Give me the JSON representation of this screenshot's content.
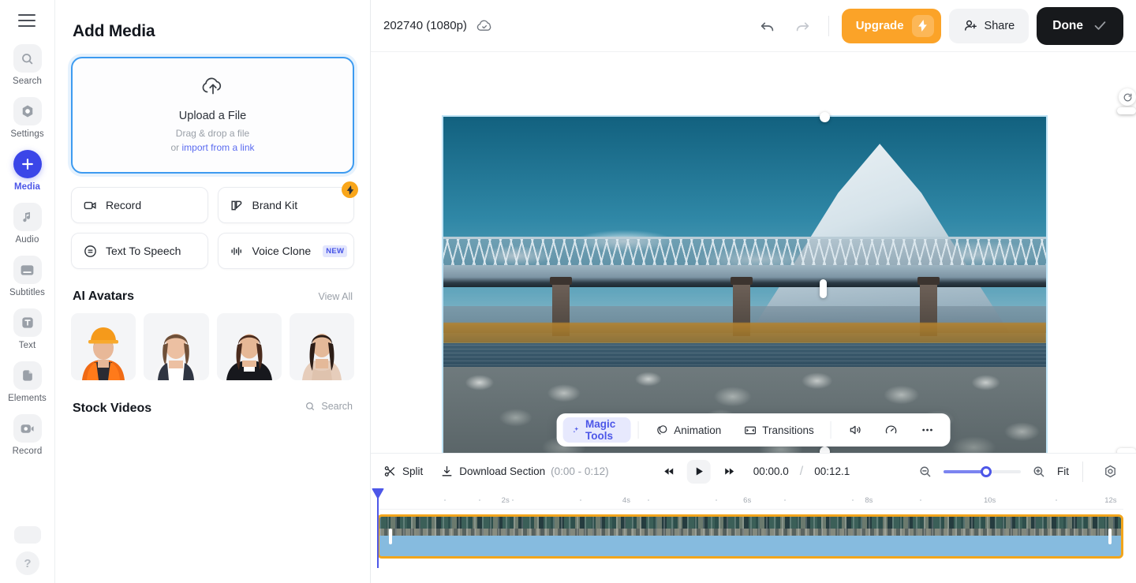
{
  "sidebar": {
    "menu_icon": "hamburger-icon",
    "items": [
      {
        "label": "Search",
        "icon": "search-icon",
        "active": false
      },
      {
        "label": "Settings",
        "icon": "gear-icon",
        "active": false
      },
      {
        "label": "Media",
        "icon": "plus-icon",
        "active": true
      },
      {
        "label": "Audio",
        "icon": "music-note-icon",
        "active": false
      },
      {
        "label": "Subtitles",
        "icon": "subtitles-icon",
        "active": false
      },
      {
        "label": "Text",
        "icon": "text-t-icon",
        "active": false
      },
      {
        "label": "Elements",
        "icon": "elements-icon",
        "active": false
      },
      {
        "label": "Record",
        "icon": "video-camera-icon",
        "active": false
      }
    ],
    "help_label": "?"
  },
  "panel": {
    "title": "Add Media",
    "dropzone": {
      "icon": "cloud-upload-icon",
      "title": "Upload a File",
      "subtitle": "Drag & drop a file",
      "or_text": "or ",
      "link_text": "import from a link"
    },
    "quick_actions": [
      {
        "label": "Record",
        "icon": "video-camera-icon",
        "badge": ""
      },
      {
        "label": "Brand Kit",
        "icon": "brand-kit-icon",
        "badge": "pro-bolt"
      },
      {
        "label": "Text To Speech",
        "icon": "speech-bubble-icon",
        "badge": ""
      },
      {
        "label": "Voice Clone",
        "icon": "waveform-icon",
        "badge": "NEW"
      }
    ],
    "avatars_section": {
      "title": "AI Avatars",
      "action": "View All",
      "items": [
        {
          "name": "construction-worker-avatar"
        },
        {
          "name": "business-woman-avatar"
        },
        {
          "name": "brunette-professional-avatar"
        },
        {
          "name": "woman-in-beige-dress-avatar"
        }
      ]
    },
    "stock_section": {
      "title": "Stock Videos",
      "search_label": "Search",
      "search_icon": "search-icon"
    }
  },
  "topbar": {
    "project_name": "202740 (1080p)",
    "cloud_icon": "cloud-saved-icon",
    "undo_icon": "undo-arrow-icon",
    "redo_icon": "redo-arrow-icon",
    "upgrade_label": "Upgrade",
    "upgrade_icon": "bolt-icon",
    "share_label": "Share",
    "share_icon": "person-add-icon",
    "done_label": "Done",
    "done_icon": "check-icon"
  },
  "canvas": {
    "rotate_icon": "rotate-icon",
    "scene": "mount-fuji-bridge-river-rocks"
  },
  "float_toolbar": {
    "items": [
      {
        "label": "Magic Tools",
        "icon": "sparkles-icon",
        "active": true
      },
      {
        "label": "Animation",
        "icon": "animation-icon",
        "active": false
      },
      {
        "label": "Transitions",
        "icon": "transitions-icon",
        "active": false
      }
    ],
    "volume_icon": "speaker-icon",
    "speed_icon": "speedometer-icon",
    "more_icon": "more-horizontal-icon"
  },
  "timeline": {
    "split_label": "Split",
    "split_icon": "scissors-icon",
    "download_label": "Download Section",
    "download_range": "(0:00 - 0:12)",
    "download_icon": "download-icon",
    "skip_back_icon": "skip-back-icon",
    "play_icon": "play-icon",
    "skip_forward_icon": "skip-forward-icon",
    "current_time": "00:00.0",
    "separator": "/",
    "total_time": "00:12.1",
    "zoom_out_icon": "zoom-out-icon",
    "zoom_in_icon": "zoom-in-icon",
    "zoom_value": 55,
    "fit_label": "Fit",
    "settings_icon": "gear-icon",
    "ruler_labels": [
      "2s",
      "4s",
      "6s",
      "8s",
      "10s",
      "12s"
    ],
    "playhead_position": "0s",
    "clip": {
      "name": "video-clip",
      "selected": true
    }
  },
  "colors": {
    "accent_indigo": "#4d57e8",
    "upgrade_orange": "#fba328",
    "clip_orange": "#f2a51c",
    "dropzone_blue": "#3d9bf0",
    "done_black": "#17191c"
  }
}
